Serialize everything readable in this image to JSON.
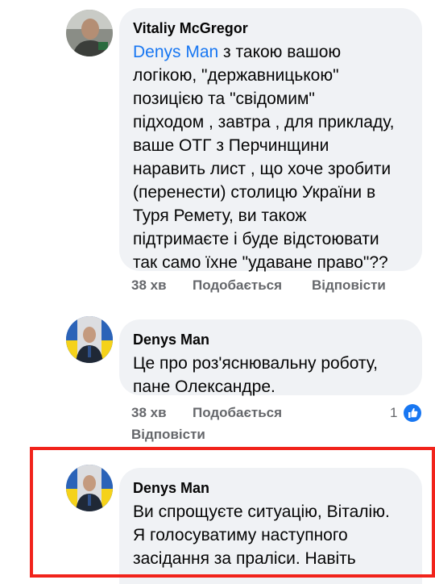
{
  "comments": [
    {
      "author": "Vitaliy McGregor",
      "mention": "Denys Man",
      "lines": [
        " з такою вашою",
        "логікою, \"державницькою\"",
        "позицією та \"свідомим\"",
        "підходом , завтра , для прикладу,",
        "ваше ОТГ з Перчинщини",
        "наравить лист , що хоче зробити",
        "(перенести) столицю України в",
        "Туря Ремету, ви також",
        "підтримаєте і буде відстоювати",
        "так само їхне \"удаване право\"??"
      ],
      "time": "38 хв",
      "like_label": "Подобається",
      "reply_label": "Відповісти"
    },
    {
      "author": "Denys Man",
      "lines": [
        "Це про роз'яснювальну роботу,",
        "пане Олександре."
      ],
      "time": "38 хв",
      "like_label": "Подобається",
      "reply_label": "Відповісти",
      "reaction_count": "1",
      "reaction_icon": "thumbs-up-icon"
    },
    {
      "author": "Denys Man",
      "lines": [
        "Ви спрощуєте ситуацію, Віталію.",
        "Я голосуватиму наступного",
        "засідання за праліси. Навіть"
      ]
    }
  ],
  "colors": {
    "mention": "#1877f2",
    "highlight": "#f1231b",
    "bubble": "#f0f2f5",
    "meta": "#65676b"
  }
}
